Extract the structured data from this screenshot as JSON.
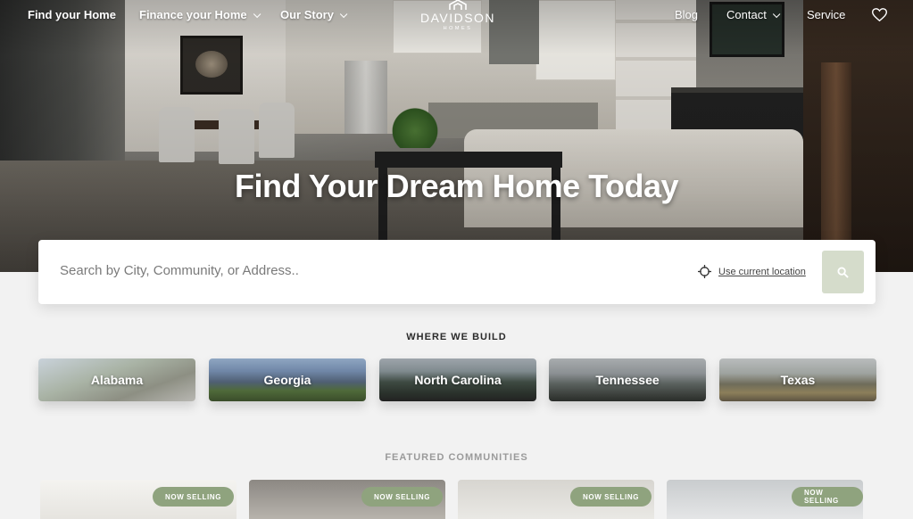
{
  "nav": {
    "find_home": "Find your Home",
    "finance": "Finance your Home",
    "our_story": "Our Story",
    "blog": "Blog",
    "contact": "Contact",
    "service": "Service"
  },
  "logo": {
    "name": "DAVIDSON",
    "sub": "HOMES"
  },
  "hero": {
    "title": "Find Your Dream Home Today"
  },
  "search": {
    "placeholder": "Search by City, Community, or Address..",
    "location_link": "Use current location"
  },
  "where_we_build": {
    "heading": "WHERE WE BUILD",
    "states": [
      "Alabama",
      "Georgia",
      "North Carolina",
      "Tennessee",
      "Texas"
    ]
  },
  "featured": {
    "heading": "FEATURED COMMUNITIES",
    "badges": [
      "NOW SELLING",
      "NOW SELLING",
      "NOW SELLING",
      "NOW SELLING"
    ]
  },
  "colors": {
    "accent_green": "#8fa37e",
    "search_button": "#d5dccb"
  },
  "icons": {
    "favorites": "heart-icon",
    "location": "crosshair-icon",
    "search": "search-icon",
    "dropdown": "chevron-down-icon"
  }
}
